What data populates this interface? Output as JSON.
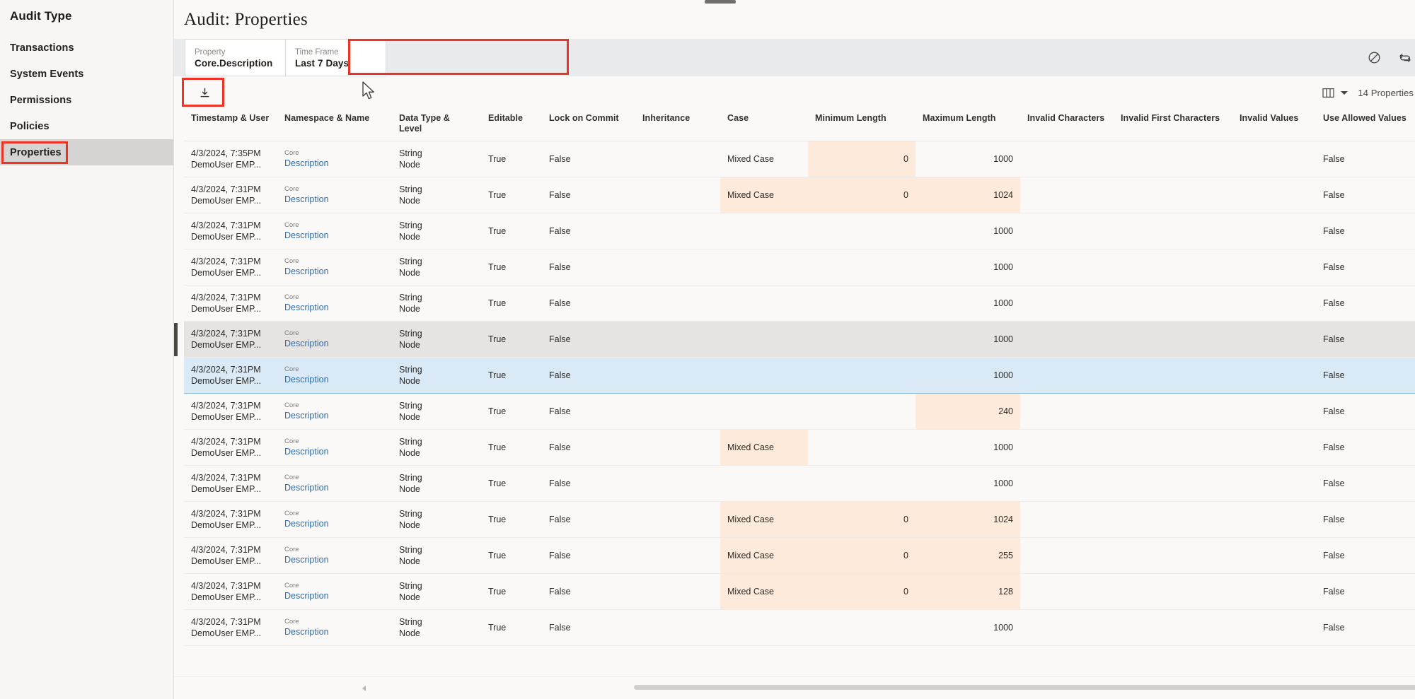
{
  "sidebar": {
    "title": "Audit Type",
    "items": [
      {
        "label": "Transactions",
        "active": false
      },
      {
        "label": "System Events",
        "active": false
      },
      {
        "label": "Permissions",
        "active": false
      },
      {
        "label": "Policies",
        "active": false
      },
      {
        "label": "Properties",
        "active": true
      }
    ]
  },
  "header": {
    "title": "Audit: Properties"
  },
  "filters": {
    "chips": [
      {
        "label": "Property",
        "value": "Core.Description"
      },
      {
        "label": "Time Frame",
        "value": "Last 7 Days"
      }
    ],
    "clear_icon": "clear-filter-icon",
    "refresh_icon": "refresh-icon"
  },
  "toolbar": {
    "export_icon": "download-icon",
    "columns_icon": "columns-icon",
    "caret_icon": "chevron-down-icon",
    "count": "14 Properties"
  },
  "table": {
    "columns": [
      "Timestamp & User",
      "Namespace & Name",
      "Data Type & Level",
      "Editable",
      "Lock on Commit",
      "Inheritance",
      "Case",
      "Minimum Length",
      "Maximum Length",
      "Invalid Characters",
      "Invalid First Characters",
      "Invalid Values",
      "Use Allowed Values"
    ],
    "rows": [
      {
        "timestamp": "4/3/2024, 7:35PM",
        "user": "DemoUser EMP...",
        "namespace": "Core",
        "name": "Description",
        "data_type": "String",
        "level": "Node",
        "editable": "True",
        "lock_on_commit": "False",
        "inheritance": "",
        "case": "Mixed Case",
        "min_length": "0",
        "max_length": "1000",
        "invalid_characters": "",
        "invalid_first_characters": "",
        "invalid_values": "",
        "use_allowed_values": "False",
        "highlight": [
          "min_length"
        ],
        "state": ""
      },
      {
        "timestamp": "4/3/2024, 7:31PM",
        "user": "DemoUser EMP...",
        "namespace": "Core",
        "name": "Description",
        "data_type": "String",
        "level": "Node",
        "editable": "True",
        "lock_on_commit": "False",
        "inheritance": "",
        "case": "Mixed Case",
        "min_length": "0",
        "max_length": "1024",
        "invalid_characters": "",
        "invalid_first_characters": "",
        "invalid_values": "",
        "use_allowed_values": "False",
        "highlight": [
          "case",
          "min_length",
          "max_length"
        ],
        "state": ""
      },
      {
        "timestamp": "4/3/2024, 7:31PM",
        "user": "DemoUser EMP...",
        "namespace": "Core",
        "name": "Description",
        "data_type": "String",
        "level": "Node",
        "editable": "True",
        "lock_on_commit": "False",
        "inheritance": "",
        "case": "",
        "min_length": "",
        "max_length": "1000",
        "invalid_characters": "",
        "invalid_first_characters": "",
        "invalid_values": "",
        "use_allowed_values": "False",
        "highlight": [],
        "state": ""
      },
      {
        "timestamp": "4/3/2024, 7:31PM",
        "user": "DemoUser EMP...",
        "namespace": "Core",
        "name": "Description",
        "data_type": "String",
        "level": "Node",
        "editable": "True",
        "lock_on_commit": "False",
        "inheritance": "",
        "case": "",
        "min_length": "",
        "max_length": "1000",
        "invalid_characters": "",
        "invalid_first_characters": "",
        "invalid_values": "",
        "use_allowed_values": "False",
        "highlight": [],
        "state": ""
      },
      {
        "timestamp": "4/3/2024, 7:31PM",
        "user": "DemoUser EMP...",
        "namespace": "Core",
        "name": "Description",
        "data_type": "String",
        "level": "Node",
        "editable": "True",
        "lock_on_commit": "False",
        "inheritance": "",
        "case": "",
        "min_length": "",
        "max_length": "1000",
        "invalid_characters": "",
        "invalid_first_characters": "",
        "invalid_values": "",
        "use_allowed_values": "False",
        "highlight": [],
        "state": ""
      },
      {
        "timestamp": "4/3/2024, 7:31PM",
        "user": "DemoUser EMP...",
        "namespace": "Core",
        "name": "Description",
        "data_type": "String",
        "level": "Node",
        "editable": "True",
        "lock_on_commit": "False",
        "inheritance": "",
        "case": "",
        "min_length": "",
        "max_length": "1000",
        "invalid_characters": "",
        "invalid_first_characters": "",
        "invalid_values": "",
        "use_allowed_values": "False",
        "highlight": [],
        "state": "hover"
      },
      {
        "timestamp": "4/3/2024, 7:31PM",
        "user": "DemoUser EMP...",
        "namespace": "Core",
        "name": "Description",
        "data_type": "String",
        "level": "Node",
        "editable": "True",
        "lock_on_commit": "False",
        "inheritance": "",
        "case": "",
        "min_length": "",
        "max_length": "1000",
        "invalid_characters": "",
        "invalid_first_characters": "",
        "invalid_values": "",
        "use_allowed_values": "False",
        "highlight": [],
        "state": "selected"
      },
      {
        "timestamp": "4/3/2024, 7:31PM",
        "user": "DemoUser EMP...",
        "namespace": "Core",
        "name": "Description",
        "data_type": "String",
        "level": "Node",
        "editable": "True",
        "lock_on_commit": "False",
        "inheritance": "",
        "case": "",
        "min_length": "",
        "max_length": "240",
        "invalid_characters": "",
        "invalid_first_characters": "",
        "invalid_values": "",
        "use_allowed_values": "False",
        "highlight": [
          "max_length"
        ],
        "state": ""
      },
      {
        "timestamp": "4/3/2024, 7:31PM",
        "user": "DemoUser EMP...",
        "namespace": "Core",
        "name": "Description",
        "data_type": "String",
        "level": "Node",
        "editable": "True",
        "lock_on_commit": "False",
        "inheritance": "",
        "case": "Mixed Case",
        "min_length": "",
        "max_length": "1000",
        "invalid_characters": "",
        "invalid_first_characters": "",
        "invalid_values": "",
        "use_allowed_values": "False",
        "highlight": [
          "case"
        ],
        "state": ""
      },
      {
        "timestamp": "4/3/2024, 7:31PM",
        "user": "DemoUser EMP...",
        "namespace": "Core",
        "name": "Description",
        "data_type": "String",
        "level": "Node",
        "editable": "True",
        "lock_on_commit": "False",
        "inheritance": "",
        "case": "",
        "min_length": "",
        "max_length": "1000",
        "invalid_characters": "",
        "invalid_first_characters": "",
        "invalid_values": "",
        "use_allowed_values": "False",
        "highlight": [],
        "state": ""
      },
      {
        "timestamp": "4/3/2024, 7:31PM",
        "user": "DemoUser EMP...",
        "namespace": "Core",
        "name": "Description",
        "data_type": "String",
        "level": "Node",
        "editable": "True",
        "lock_on_commit": "False",
        "inheritance": "",
        "case": "Mixed Case",
        "min_length": "0",
        "max_length": "1024",
        "invalid_characters": "",
        "invalid_first_characters": "",
        "invalid_values": "",
        "use_allowed_values": "False",
        "highlight": [
          "case",
          "min_length",
          "max_length"
        ],
        "state": ""
      },
      {
        "timestamp": "4/3/2024, 7:31PM",
        "user": "DemoUser EMP...",
        "namespace": "Core",
        "name": "Description",
        "data_type": "String",
        "level": "Node",
        "editable": "True",
        "lock_on_commit": "False",
        "inheritance": "",
        "case": "Mixed Case",
        "min_length": "0",
        "max_length": "255",
        "invalid_characters": "",
        "invalid_first_characters": "",
        "invalid_values": "",
        "use_allowed_values": "False",
        "highlight": [
          "case",
          "min_length",
          "max_length"
        ],
        "state": ""
      },
      {
        "timestamp": "4/3/2024, 7:31PM",
        "user": "DemoUser EMP...",
        "namespace": "Core",
        "name": "Description",
        "data_type": "String",
        "level": "Node",
        "editable": "True",
        "lock_on_commit": "False",
        "inheritance": "",
        "case": "Mixed Case",
        "min_length": "0",
        "max_length": "128",
        "invalid_characters": "",
        "invalid_first_characters": "",
        "invalid_values": "",
        "use_allowed_values": "False",
        "highlight": [
          "case",
          "min_length",
          "max_length"
        ],
        "state": ""
      },
      {
        "timestamp": "4/3/2024, 7:31PM",
        "user": "DemoUser EMP...",
        "namespace": "Core",
        "name": "Description",
        "data_type": "String",
        "level": "Node",
        "editable": "True",
        "lock_on_commit": "False",
        "inheritance": "",
        "case": "",
        "min_length": "",
        "max_length": "1000",
        "invalid_characters": "",
        "invalid_first_characters": "",
        "invalid_values": "",
        "use_allowed_values": "False",
        "highlight": [],
        "state": ""
      }
    ]
  },
  "colors": {
    "highlight": "#fdeada",
    "selected_row": "#d9eaf6",
    "hover_row": "#e6e4e2",
    "annotation": "#ee3224",
    "link": "#2d6ca8",
    "filter_bar": "#e9eaec"
  }
}
